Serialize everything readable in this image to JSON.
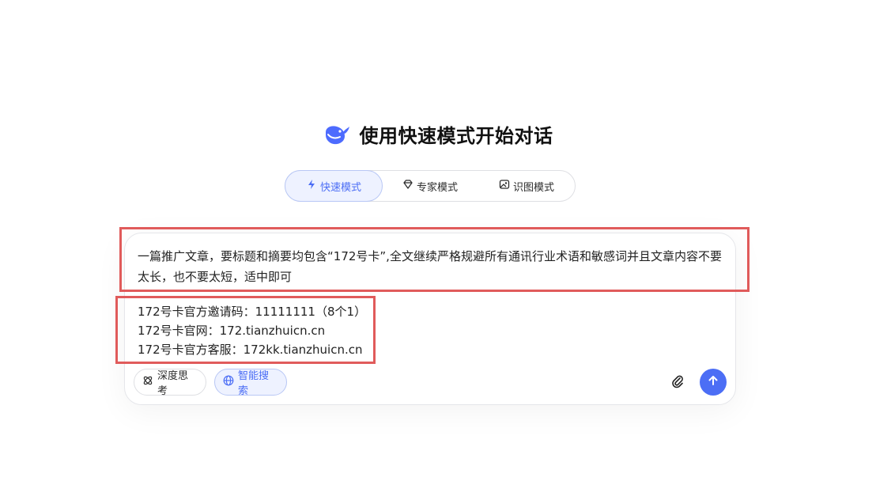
{
  "header": {
    "title": "使用快速模式开始对话",
    "logo_icon": "whale-logo-icon"
  },
  "modes": [
    {
      "label": "快速模式",
      "icon": "bolt-icon",
      "active": true
    },
    {
      "label": "专家模式",
      "icon": "diamond-icon",
      "active": false
    },
    {
      "label": "识图模式",
      "icon": "image-icon",
      "active": false
    }
  ],
  "composer": {
    "prompt": "一篇推广文章，要标题和摘要均包含“172号卡”,全文继续严格规避所有通讯行业术语和敏感词并且文章内容不要太长，也不要太短，适中即可",
    "info_lines": [
      "172号卡官方邀请码：11111111（8个1）",
      "172号卡官网：172.tianzhuicn.cn",
      "172号卡官方客服：172kk.tianzhuicn.cn"
    ],
    "deep_think_label": "深度思考",
    "smart_search_label": "智能搜索"
  },
  "colors": {
    "accent": "#4c6ef5",
    "highlight": "#e05b5b"
  }
}
